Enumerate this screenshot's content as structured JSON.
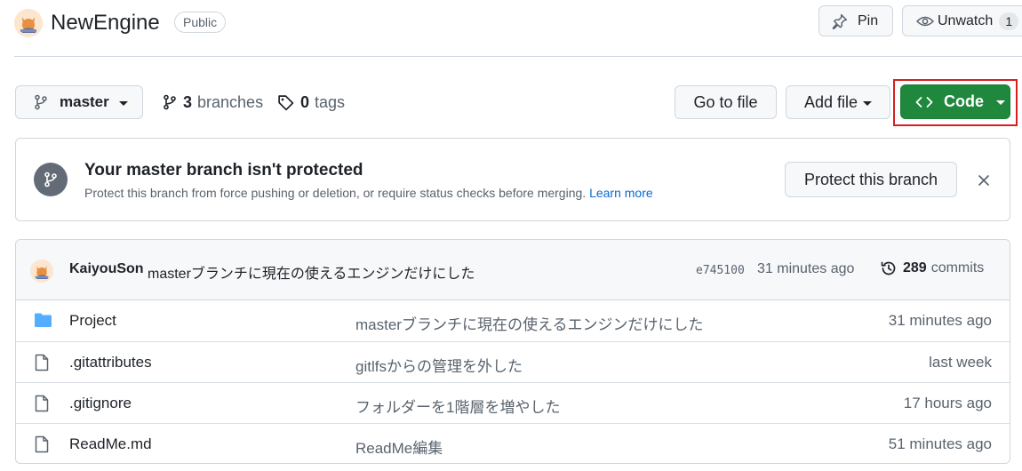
{
  "repo": {
    "name": "NewEngine",
    "visibility": "Public",
    "pin_label": "Pin",
    "watch_label": "Unwatch",
    "watch_count": "1"
  },
  "toolbar": {
    "branch": "master",
    "branches_count": "3",
    "branches_label": "branches",
    "tags_count": "0",
    "tags_label": "tags",
    "goto_label": "Go to file",
    "addfile_label": "Add file",
    "code_label": "Code"
  },
  "protect": {
    "title": "Your master branch isn't protected",
    "description": "Protect this branch from force pushing or deletion, or require status checks before merging.",
    "learn_more": "Learn more",
    "button": "Protect this branch"
  },
  "latest_commit": {
    "author": "KaiyouSon",
    "message": "masterブランチに現在の使えるエンジンだけにした",
    "sha": "e745100",
    "time": "31 minutes ago",
    "commits_count": "289",
    "commits_label": "commits"
  },
  "files": [
    {
      "type": "folder",
      "icon": "folder-icon",
      "name": "Project",
      "message": "masterブランチに現在の使えるエンジンだけにした",
      "time": "31 minutes ago"
    },
    {
      "type": "file",
      "icon": "file-icon",
      "name": ".gitattributes",
      "message": "gitlfsからの管理を外した",
      "time": "last week"
    },
    {
      "type": "file",
      "icon": "file-icon",
      "name": ".gitignore",
      "message": "フォルダーを1階層を増やした",
      "time": "17 hours ago"
    },
    {
      "type": "file",
      "icon": "file-icon",
      "name": "ReadMe.md",
      "message": "ReadMe編集",
      "time": "51 minutes ago"
    }
  ],
  "colors": {
    "accent_green": "#1f883d",
    "link_blue": "#0969da",
    "highlight_red": "#d61f1f",
    "folder_blue": "#54aeff"
  }
}
